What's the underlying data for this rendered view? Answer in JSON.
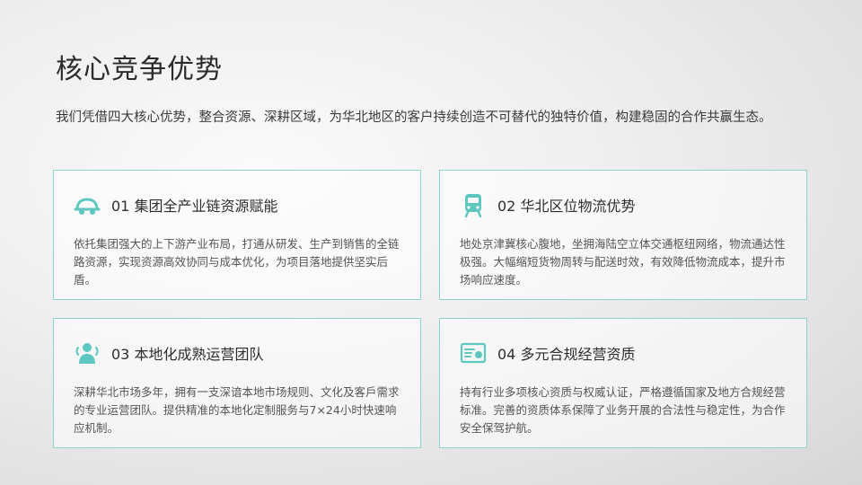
{
  "slide": {
    "title": "核心竞争优势",
    "intro": "我们凭借四大核心优势，整合资源、深耕区域，为华北地区的客户持续创造不可替代的独特价值，构建稳固的合作共赢生态。"
  },
  "cards": [
    {
      "icon": "car-icon",
      "title": "01 集团全产业链资源赋能",
      "body": "依托集团强大的上下游产业布局，打通从研发、生产到销售的全链路资源，实现资源高效协同与成本优化，为项目落地提供坚实后盾。"
    },
    {
      "icon": "train-icon",
      "title": "02 华北区位物流优势",
      "body": "地处京津冀核心腹地，坐拥海陆空立体交通枢纽网络，物流通达性极强。大幅缩短货物周转与配送时效，有效降低物流成本，提升市场响应速度。"
    },
    {
      "icon": "team-icon",
      "title": "03 本地化成熟运营团队",
      "body": "深耕华北市场多年，拥有一支深谙本地市场规则、文化及客戶需求的专业运营团队。提供精准的本地化定制服务与7×24小时快速响应机制。"
    },
    {
      "icon": "certificate-icon",
      "title": "04 多元合规经营资质",
      "body": "持有行业多项核心资质与权威认证，严格遵循国家及地方合规经营标准。完善的资质体系保障了业务开展的合法性与稳定性，为合作安全保驾护航。"
    }
  ],
  "colors": {
    "accent": "#5ec8c0",
    "border": "#8fd3cd"
  }
}
